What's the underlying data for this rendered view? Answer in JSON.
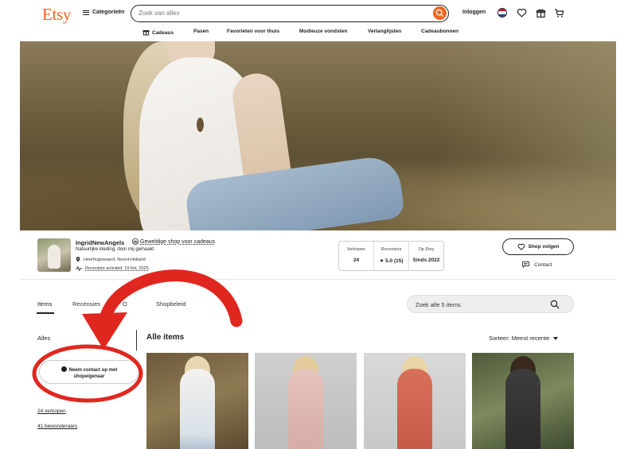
{
  "header": {
    "logo": "Etsy",
    "categories_label": "Categorieën",
    "search_placeholder": "Zoek van alles",
    "login_label": "Inloggen"
  },
  "subnav": [
    {
      "label": "Cadeaus",
      "icon": "gift-icon"
    },
    {
      "label": "Pasen"
    },
    {
      "label": "Favorieten voor thuis"
    },
    {
      "label": "Modieuze vondsten"
    },
    {
      "label": "Verlanglijsten"
    },
    {
      "label": "Cadeaubonnen"
    }
  ],
  "shop": {
    "name": "IngridNewAngels",
    "badge": "Geweldige shop voor cadeaus",
    "tagline": "Natuurlijke kleding, door mij gemaakt",
    "location": "Heerhugowaard, Noord-Holland",
    "activity": "Recentste activiteit: 19 feb. 2025",
    "stats": [
      {
        "label": "Verkopen",
        "value": "24"
      },
      {
        "label": "Recensies",
        "value": "★ 5.0 (15)"
      },
      {
        "label": "Op Etsy",
        "value": "Sinds 2022"
      }
    ],
    "follow_label": "Shop volgen",
    "contact_label": "Contact"
  },
  "tabs": {
    "items": "Items",
    "reviews": "Recensies",
    "about_partial": "O",
    "policies": "Shopbeleid"
  },
  "shop_search_placeholder": "Zoek alle 5 items",
  "sidebar": {
    "all_label": "Alles",
    "contact_owner_line1": "Neem contact op met",
    "contact_owner_line2": "shopeigenaar",
    "sales_link": "24 verkopen",
    "admirers_link": "41 bewonderaars"
  },
  "items_section": {
    "heading": "Alle items",
    "sort_label": "Sorteer: Meest recente"
  },
  "colors": {
    "brand": "#F1641E",
    "annotation": "#E0271F"
  }
}
